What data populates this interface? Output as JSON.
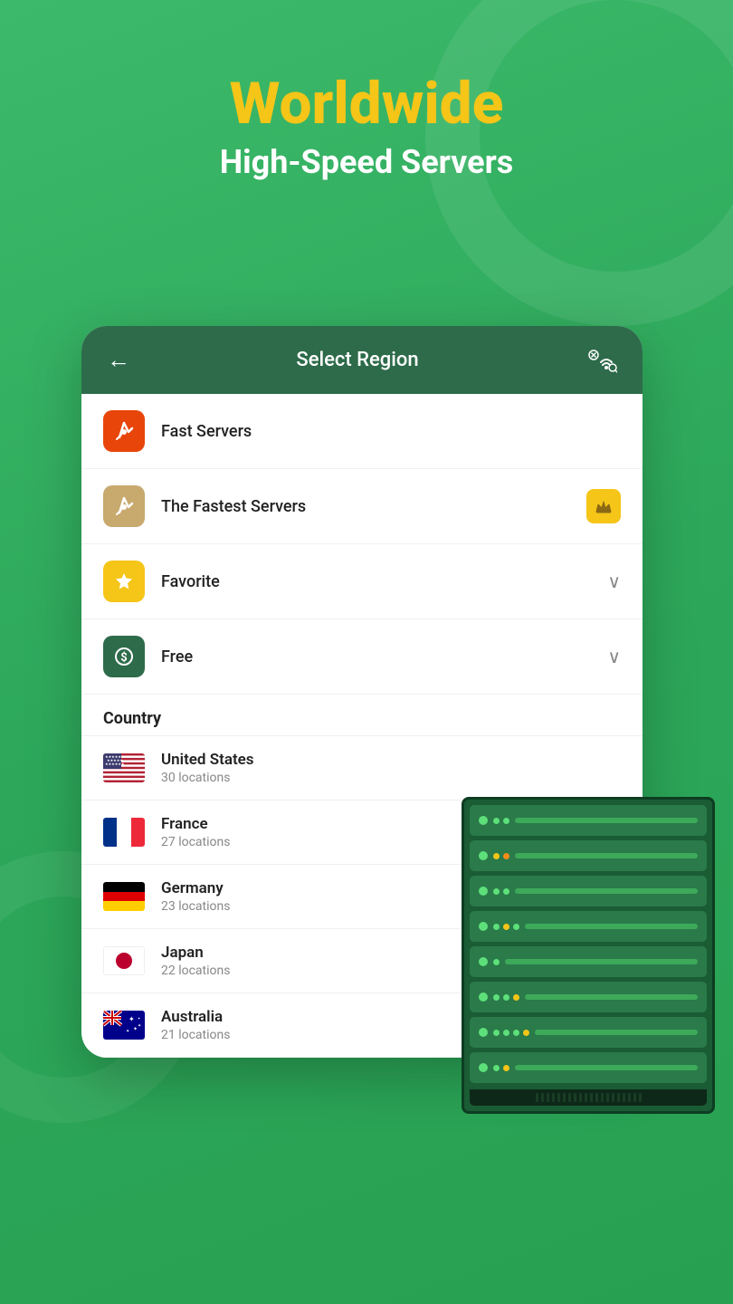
{
  "header": {
    "title_line1": "Worldwide",
    "title_line2": "High-Speed Servers"
  },
  "card": {
    "title": "Select Region",
    "back_arrow": "←",
    "menu_items": [
      {
        "id": "fast-servers",
        "label": "Fast Servers",
        "icon_char": "🚀",
        "icon_bg": "fast",
        "right": null
      },
      {
        "id": "fastest-servers",
        "label": "The Fastest Servers",
        "icon_char": "🚀",
        "icon_bg": "fastest",
        "right": "crown"
      },
      {
        "id": "favorite",
        "label": "Favorite",
        "icon_char": "⭐",
        "icon_bg": "favorite",
        "right": "chevron"
      },
      {
        "id": "free",
        "label": "Free",
        "icon_char": "💲",
        "icon_bg": "free",
        "right": "chevron"
      }
    ],
    "country_label": "Country",
    "countries": [
      {
        "id": "us",
        "name": "United States",
        "locations": "30 locations",
        "flag_type": "us"
      },
      {
        "id": "fr",
        "name": "France",
        "locations": "27 locations",
        "flag_type": "fr"
      },
      {
        "id": "de",
        "name": "Germany",
        "locations": "23 locations",
        "flag_type": "de"
      },
      {
        "id": "jp",
        "name": "Japan",
        "locations": "22 locations",
        "flag_type": "jp"
      },
      {
        "id": "au",
        "name": "Australia",
        "locations": "21 locations",
        "flag_type": "au"
      }
    ]
  },
  "server_units": [
    {
      "dots": [
        "green",
        "green",
        "yellow"
      ],
      "bar": true
    },
    {
      "dots": [
        "green",
        "yellow",
        "orange"
      ],
      "bar": true
    },
    {
      "dots": [
        "green",
        "green",
        "green"
      ],
      "bar": true
    },
    {
      "dots": [
        "green",
        "yellow",
        "green",
        "green"
      ],
      "bar": true
    },
    {
      "dots": [
        "green",
        "green"
      ],
      "bar": true
    },
    {
      "dots": [
        "green",
        "green",
        "yellow",
        "green"
      ],
      "bar": true
    },
    {
      "dots": [
        "green",
        "green",
        "green",
        "yellow"
      ],
      "bar": true
    },
    {
      "dots": [
        "green",
        "yellow"
      ],
      "bar": true
    }
  ]
}
